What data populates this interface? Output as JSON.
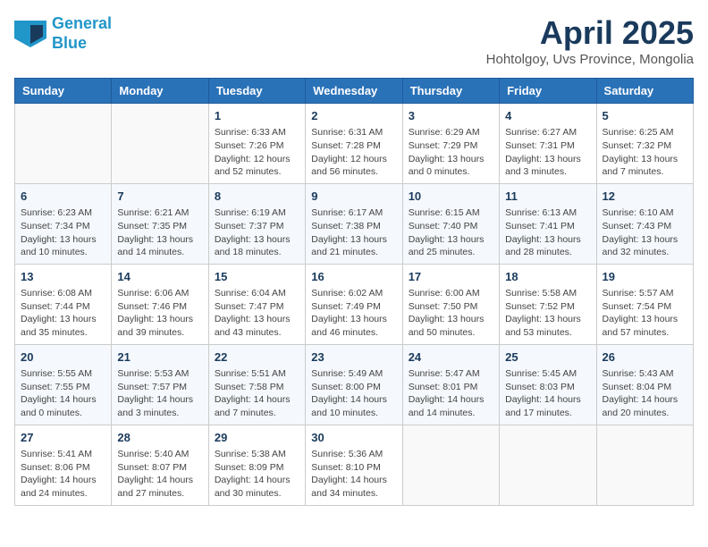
{
  "header": {
    "logo_line1": "General",
    "logo_line2": "Blue",
    "title": "April 2025",
    "subtitle": "Hohtolgoy, Uvs Province, Mongolia"
  },
  "days_of_week": [
    "Sunday",
    "Monday",
    "Tuesday",
    "Wednesday",
    "Thursday",
    "Friday",
    "Saturday"
  ],
  "weeks": [
    [
      {
        "day": "",
        "info": ""
      },
      {
        "day": "",
        "info": ""
      },
      {
        "day": "1",
        "info": "Sunrise: 6:33 AM\nSunset: 7:26 PM\nDaylight: 12 hours and 52 minutes."
      },
      {
        "day": "2",
        "info": "Sunrise: 6:31 AM\nSunset: 7:28 PM\nDaylight: 12 hours and 56 minutes."
      },
      {
        "day": "3",
        "info": "Sunrise: 6:29 AM\nSunset: 7:29 PM\nDaylight: 13 hours and 0 minutes."
      },
      {
        "day": "4",
        "info": "Sunrise: 6:27 AM\nSunset: 7:31 PM\nDaylight: 13 hours and 3 minutes."
      },
      {
        "day": "5",
        "info": "Sunrise: 6:25 AM\nSunset: 7:32 PM\nDaylight: 13 hours and 7 minutes."
      }
    ],
    [
      {
        "day": "6",
        "info": "Sunrise: 6:23 AM\nSunset: 7:34 PM\nDaylight: 13 hours and 10 minutes."
      },
      {
        "day": "7",
        "info": "Sunrise: 6:21 AM\nSunset: 7:35 PM\nDaylight: 13 hours and 14 minutes."
      },
      {
        "day": "8",
        "info": "Sunrise: 6:19 AM\nSunset: 7:37 PM\nDaylight: 13 hours and 18 minutes."
      },
      {
        "day": "9",
        "info": "Sunrise: 6:17 AM\nSunset: 7:38 PM\nDaylight: 13 hours and 21 minutes."
      },
      {
        "day": "10",
        "info": "Sunrise: 6:15 AM\nSunset: 7:40 PM\nDaylight: 13 hours and 25 minutes."
      },
      {
        "day": "11",
        "info": "Sunrise: 6:13 AM\nSunset: 7:41 PM\nDaylight: 13 hours and 28 minutes."
      },
      {
        "day": "12",
        "info": "Sunrise: 6:10 AM\nSunset: 7:43 PM\nDaylight: 13 hours and 32 minutes."
      }
    ],
    [
      {
        "day": "13",
        "info": "Sunrise: 6:08 AM\nSunset: 7:44 PM\nDaylight: 13 hours and 35 minutes."
      },
      {
        "day": "14",
        "info": "Sunrise: 6:06 AM\nSunset: 7:46 PM\nDaylight: 13 hours and 39 minutes."
      },
      {
        "day": "15",
        "info": "Sunrise: 6:04 AM\nSunset: 7:47 PM\nDaylight: 13 hours and 43 minutes."
      },
      {
        "day": "16",
        "info": "Sunrise: 6:02 AM\nSunset: 7:49 PM\nDaylight: 13 hours and 46 minutes."
      },
      {
        "day": "17",
        "info": "Sunrise: 6:00 AM\nSunset: 7:50 PM\nDaylight: 13 hours and 50 minutes."
      },
      {
        "day": "18",
        "info": "Sunrise: 5:58 AM\nSunset: 7:52 PM\nDaylight: 13 hours and 53 minutes."
      },
      {
        "day": "19",
        "info": "Sunrise: 5:57 AM\nSunset: 7:54 PM\nDaylight: 13 hours and 57 minutes."
      }
    ],
    [
      {
        "day": "20",
        "info": "Sunrise: 5:55 AM\nSunset: 7:55 PM\nDaylight: 14 hours and 0 minutes."
      },
      {
        "day": "21",
        "info": "Sunrise: 5:53 AM\nSunset: 7:57 PM\nDaylight: 14 hours and 3 minutes."
      },
      {
        "day": "22",
        "info": "Sunrise: 5:51 AM\nSunset: 7:58 PM\nDaylight: 14 hours and 7 minutes."
      },
      {
        "day": "23",
        "info": "Sunrise: 5:49 AM\nSunset: 8:00 PM\nDaylight: 14 hours and 10 minutes."
      },
      {
        "day": "24",
        "info": "Sunrise: 5:47 AM\nSunset: 8:01 PM\nDaylight: 14 hours and 14 minutes."
      },
      {
        "day": "25",
        "info": "Sunrise: 5:45 AM\nSunset: 8:03 PM\nDaylight: 14 hours and 17 minutes."
      },
      {
        "day": "26",
        "info": "Sunrise: 5:43 AM\nSunset: 8:04 PM\nDaylight: 14 hours and 20 minutes."
      }
    ],
    [
      {
        "day": "27",
        "info": "Sunrise: 5:41 AM\nSunset: 8:06 PM\nDaylight: 14 hours and 24 minutes."
      },
      {
        "day": "28",
        "info": "Sunrise: 5:40 AM\nSunset: 8:07 PM\nDaylight: 14 hours and 27 minutes."
      },
      {
        "day": "29",
        "info": "Sunrise: 5:38 AM\nSunset: 8:09 PM\nDaylight: 14 hours and 30 minutes."
      },
      {
        "day": "30",
        "info": "Sunrise: 5:36 AM\nSunset: 8:10 PM\nDaylight: 14 hours and 34 minutes."
      },
      {
        "day": "",
        "info": ""
      },
      {
        "day": "",
        "info": ""
      },
      {
        "day": "",
        "info": ""
      }
    ]
  ]
}
